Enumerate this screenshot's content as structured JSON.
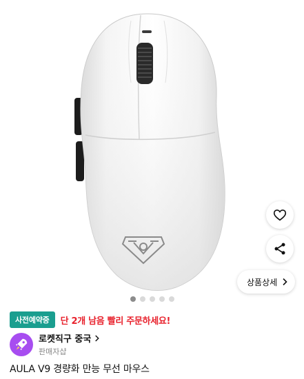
{
  "product_image": {
    "alt": "product-photo",
    "dot_count": 5,
    "active_dot": 0
  },
  "actions": {
    "like_icon": "heart-icon",
    "share_icon": "share-icon",
    "detail_label": "상품상세"
  },
  "badge": {
    "label": "사전예약중",
    "color": "#1a9e8f"
  },
  "stock_notice": {
    "text": "단 2개 남음 빨리 주문하세요!",
    "color": "#e8212c"
  },
  "seller": {
    "name": "로켓직구 중국",
    "sub_label": "판매자샵",
    "avatar_color": "#a74df0"
  },
  "product": {
    "title": "AULA V9 경량화 만능 무선 마우스"
  }
}
